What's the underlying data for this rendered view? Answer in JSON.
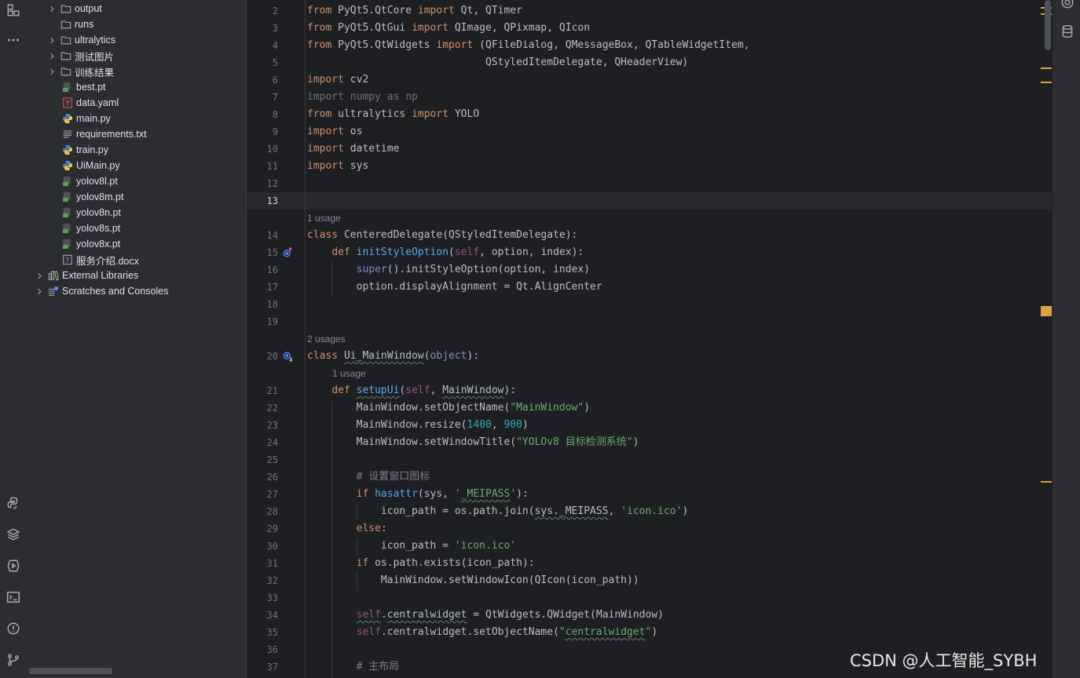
{
  "left_strip": {
    "icons": [
      "structure-icon",
      "more-icon",
      "python-console-icon",
      "layers-icon",
      "run-icon",
      "terminal-icon",
      "problems-icon",
      "git-icon"
    ]
  },
  "project_tree": [
    {
      "label": "output",
      "type": "folder",
      "expandable": true
    },
    {
      "label": "runs",
      "type": "folder",
      "expandable": false
    },
    {
      "label": "ultralytics",
      "type": "folder",
      "expandable": true
    },
    {
      "label": "测试图片",
      "type": "folder",
      "expandable": true
    },
    {
      "label": "训练结果",
      "type": "folder",
      "expandable": true
    },
    {
      "label": "best.pt",
      "type": "pt",
      "expandable": false
    },
    {
      "label": "data.yaml",
      "type": "yaml",
      "expandable": false
    },
    {
      "label": "main.py",
      "type": "py",
      "expandable": false
    },
    {
      "label": "requirements.txt",
      "type": "txt",
      "expandable": false
    },
    {
      "label": "train.py",
      "type": "py",
      "expandable": false
    },
    {
      "label": "UiMain.py",
      "type": "py",
      "expandable": false
    },
    {
      "label": "yolov8l.pt",
      "type": "pt",
      "expandable": false
    },
    {
      "label": "yolov8m.pt",
      "type": "pt",
      "expandable": false
    },
    {
      "label": "yolov8n.pt",
      "type": "pt",
      "expandable": false
    },
    {
      "label": "yolov8s.pt",
      "type": "pt",
      "expandable": false
    },
    {
      "label": "yolov8x.pt",
      "type": "pt",
      "expandable": false
    },
    {
      "label": "服务介绍.docx",
      "type": "unknown",
      "expandable": false
    },
    {
      "label": "External Libraries",
      "type": "library",
      "expandable": true
    },
    {
      "label": "Scratches and Consoles",
      "type": "scratch",
      "expandable": true
    }
  ],
  "editor": {
    "line_numbers": [
      "2",
      "3",
      "4",
      "5",
      "6",
      "7",
      "8",
      "9",
      "10",
      "11",
      "12",
      "13",
      "14",
      "15",
      "16",
      "17",
      "18",
      "19",
      "20",
      "21",
      "22",
      "23",
      "24",
      "25",
      "26",
      "27",
      "28",
      "29",
      "30",
      "31",
      "32",
      "33",
      "34",
      "35",
      "36",
      "37"
    ],
    "current_line": "13",
    "usage_hints": [
      "1 usage",
      "2 usages",
      "1 usage"
    ],
    "lines": {
      "l2": [
        "from",
        " PyQt5.QtCore ",
        "import",
        " Qt, QTimer"
      ],
      "l3": [
        "from",
        " PyQt5.QtGui ",
        "import",
        " QImage, QPixmap, QIcon"
      ],
      "l4": [
        "from",
        " PyQt5.QtWidgets ",
        "import",
        " (QFileDialog, QMessageBox, QTableWidgetItem,"
      ],
      "l5": [
        "                             QStyledItemDelegate, QHeaderView)"
      ],
      "l6": [
        "import",
        " cv2"
      ],
      "l7": [
        "import numpy as np"
      ],
      "l8": [
        "from",
        " ultralytics ",
        "import",
        " YOLO"
      ],
      "l9": [
        "import",
        " os"
      ],
      "l10": [
        "import",
        " datetime"
      ],
      "l11": [
        "import",
        " sys"
      ],
      "l14": [
        "class",
        " CenteredDelegate(QStyledItemDelegate):"
      ],
      "l15": [
        "    ",
        "def",
        " ",
        "initStyleOption",
        "(",
        "self",
        ", option, index):"
      ],
      "l16": [
        "        ",
        "super",
        "().initStyleOption(option, index)"
      ],
      "l17": [
        "        option.displayAlignment = Qt.AlignCenter"
      ],
      "l20": [
        "class",
        " ",
        "Ui_MainWindow",
        "(",
        "object",
        "):"
      ],
      "l21": [
        "    ",
        "def",
        " ",
        "setupUi",
        "(",
        "self",
        ", ",
        "MainWindow",
        "):"
      ],
      "l22": [
        "        MainWindow.setObjectName(",
        "\"MainWindow\"",
        ")"
      ],
      "l23": [
        "        MainWindow.resize(",
        "1400",
        ", ",
        "900",
        ")"
      ],
      "l24": [
        "        MainWindow.setWindowTitle(",
        "\"YOLOv8 目标检测系统\"",
        ")"
      ],
      "l26": [
        "        # 设置窗口图标"
      ],
      "l27": [
        "        ",
        "if",
        " ",
        "hasattr",
        "(sys, ",
        "'",
        "_MEIPASS",
        "'",
        "):"
      ],
      "l28": [
        "            icon_path = os.path.join(",
        "sys._MEIPASS",
        ", ",
        "'icon.ico'",
        ")"
      ],
      "l29": [
        "        ",
        "else",
        ":"
      ],
      "l30": [
        "            icon_path = ",
        "'icon.ico'"
      ],
      "l31": [
        "        ",
        "if",
        " os.path.exists(icon_path):"
      ],
      "l32": [
        "            MainWindow.setWindowIcon(QIcon(icon_path))"
      ],
      "l34": [
        "        ",
        "self",
        ".",
        "centralwidget",
        " = QtWidgets.QWidget(MainWindow)"
      ],
      "l35": [
        "        ",
        "self",
        ".centralwidget.setObjectName(",
        "\"",
        "centralwidget",
        "\"",
        ")"
      ],
      "l37": [
        "        # 主布局"
      ]
    }
  },
  "watermark": "CSDN @人工智能_SYBH",
  "colors": {
    "keyword": "#cf8e6d",
    "string": "#6aab73",
    "number": "#2aacb8",
    "function": "#56a8f5",
    "self": "#94558d",
    "builtin": "#8888c6",
    "comment": "#7a7e85"
  }
}
